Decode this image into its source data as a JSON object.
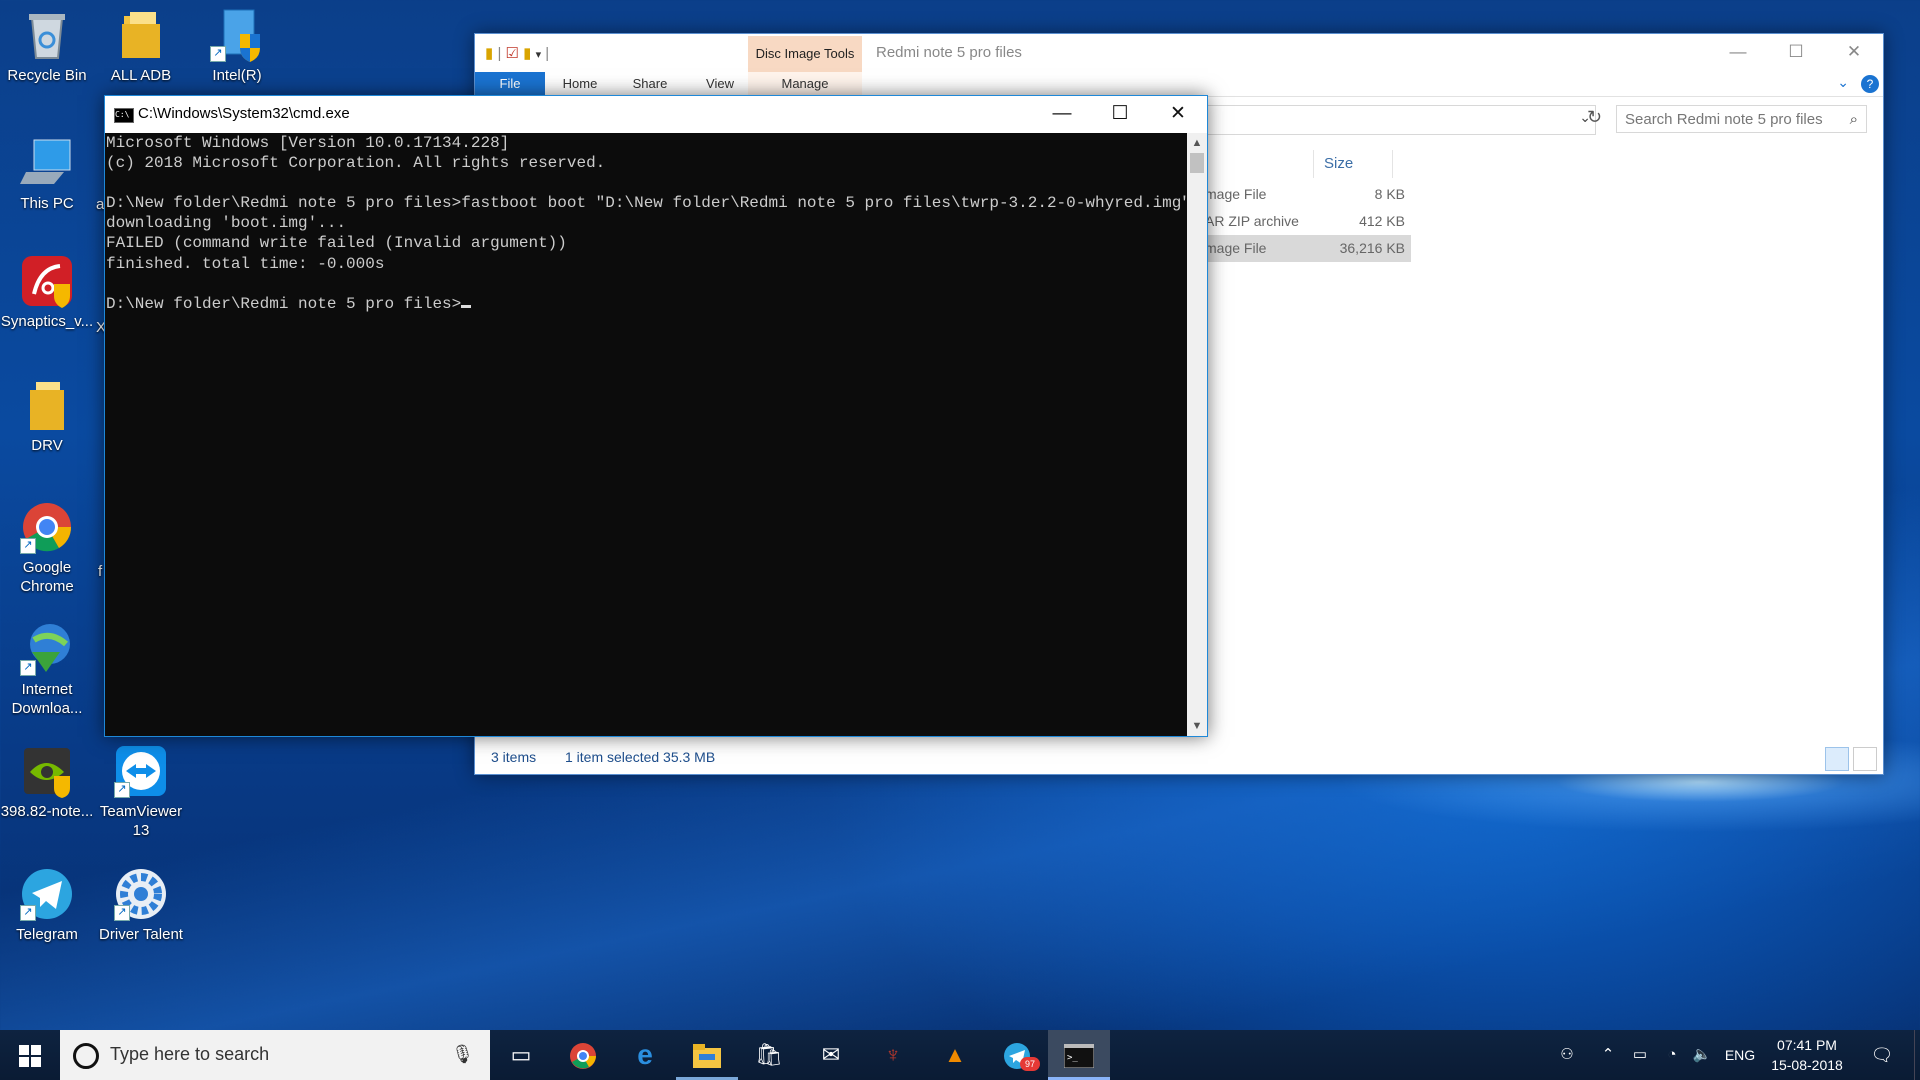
{
  "desktop": {
    "icons": [
      {
        "label": "Recycle Bin",
        "icon": "recycle-bin-icon"
      },
      {
        "label": "ALL ADB",
        "icon": "folder-icon"
      },
      {
        "label": "Intel(R)",
        "icon": "intel-setup-icon"
      },
      {
        "label": "This PC",
        "icon": "computer-icon"
      },
      {
        "label": "Synaptics_v...",
        "icon": "synaptics-icon"
      },
      {
        "label": "DRV",
        "icon": "folder-icon"
      },
      {
        "label": "Google Chrome",
        "icon": "chrome-icon"
      },
      {
        "label": "Internet Downloa...",
        "icon": "internet-download-manager-icon"
      },
      {
        "label": "398.82-note...",
        "icon": "nvidia-icon"
      },
      {
        "label": "TeamViewer 13",
        "icon": "teamviewer-icon"
      },
      {
        "label": "Telegram",
        "icon": "telegram-icon"
      },
      {
        "label": "Driver Talent",
        "icon": "driver-talent-icon"
      }
    ],
    "partial_labels": {
      "col2_row3": "X",
      "col2_row5": "f",
      "col2_row2": "a"
    }
  },
  "explorer": {
    "title": "Redmi note 5 pro files",
    "context_tab": "Disc Image Tools",
    "ribbon_tabs": [
      "File",
      "Home",
      "Share",
      "View",
      "Manage"
    ],
    "search_placeholder": "Search Redmi note 5 pro files",
    "column_header": "Size",
    "rows": [
      {
        "type": "mage File",
        "size": "8 KB",
        "selected": false
      },
      {
        "type": "AR ZIP archive",
        "size": "412 KB",
        "selected": false
      },
      {
        "type": "mage File",
        "size": "36,216 KB",
        "selected": true
      }
    ],
    "status": {
      "items": "3 items",
      "selected": "1 item selected  35.3 MB"
    }
  },
  "cmd": {
    "title": "C:\\Windows\\System32\\cmd.exe",
    "lines": [
      "Microsoft Windows [Version 10.0.17134.228]",
      "(c) 2018 Microsoft Corporation. All rights reserved.",
      "",
      "D:\\New folder\\Redmi note 5 pro files>fastboot boot \"D:\\New folder\\Redmi note 5 pro files\\twrp-3.2.2-0-whyred.img\"",
      "downloading 'boot.img'...",
      "FAILED (command write failed (Invalid argument))",
      "finished. total time: -0.000s",
      ""
    ],
    "prompt": "D:\\New folder\\Redmi note 5 pro files>"
  },
  "taskbar": {
    "search_placeholder": "Type here to search",
    "apps": [
      "task-view-icon",
      "chrome-icon",
      "edge-icon",
      "file-explorer-icon",
      "store-icon",
      "mail-icon",
      "predator-icon",
      "vlc-icon",
      "telegram-icon",
      "cmd-icon"
    ],
    "telegram_badge": "97",
    "language": "ENG",
    "time": "07:41 PM",
    "date": "15-08-2018"
  }
}
